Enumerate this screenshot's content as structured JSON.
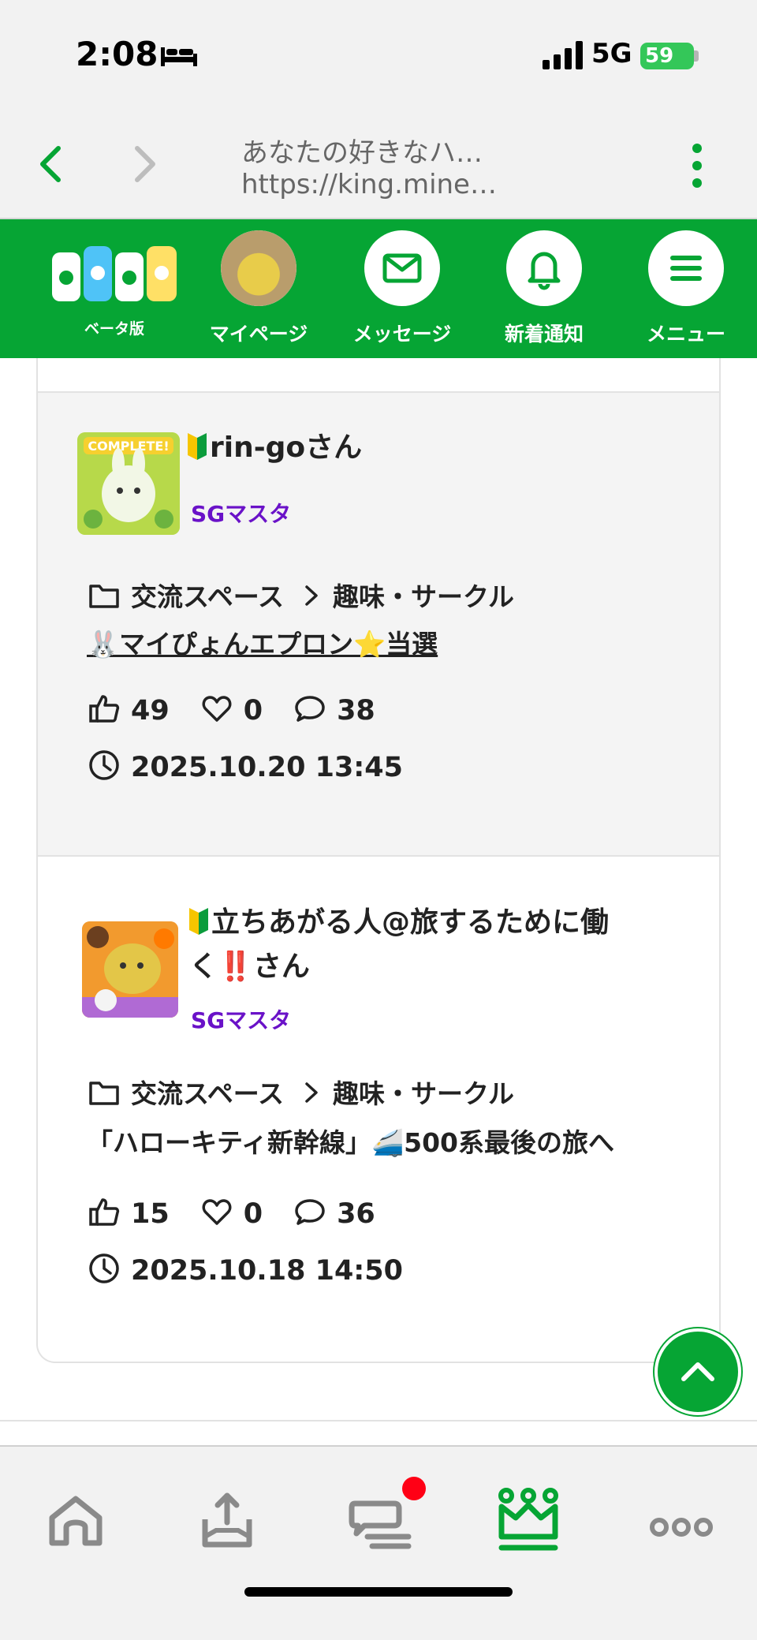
{
  "status_bar": {
    "time": "2:08",
    "network": "5G",
    "battery": "59"
  },
  "browser": {
    "page_title": "あなたの好きなハ…",
    "url": "https://king.mine…"
  },
  "header": {
    "logo_sub": "ベータ版",
    "items": [
      {
        "label": "マイページ",
        "icon": "avatar"
      },
      {
        "label": "メッセージ",
        "icon": "envelope-icon"
      },
      {
        "label": "新着通知",
        "icon": "bell-icon"
      },
      {
        "label": "メニュー",
        "icon": "hamburger-icon"
      }
    ]
  },
  "posts": [
    {
      "user": "rin-goさん",
      "rank": "SGマスタ",
      "category": "交流スペース",
      "subcategory": "趣味・サークル",
      "title": "🐰マイぴょんエプロン⭐当選",
      "likes": "49",
      "favorites": "0",
      "comments": "38",
      "datetime": "2025.10.20 13:45"
    },
    {
      "user_line1": "立ちあがる人@旅するために働",
      "user_line2": "く‼️さん",
      "rank": "SGマスタ",
      "category": "交流スペース",
      "subcategory": "趣味・サークル",
      "title": "「ハローキティ新幹線」🚄500系最後の旅へ",
      "likes": "15",
      "favorites": "0",
      "comments": "36",
      "datetime": "2025.10.18 14:50"
    }
  ],
  "tabbar": {
    "tabs": [
      "home-icon",
      "upload-icon",
      "chat-icon",
      "crown-icon",
      "more-icon"
    ],
    "active": "crown-icon"
  },
  "colors": {
    "brand_green": "#06a534",
    "rank_purple": "#6a12c8",
    "badge_red": "#ff0015"
  }
}
